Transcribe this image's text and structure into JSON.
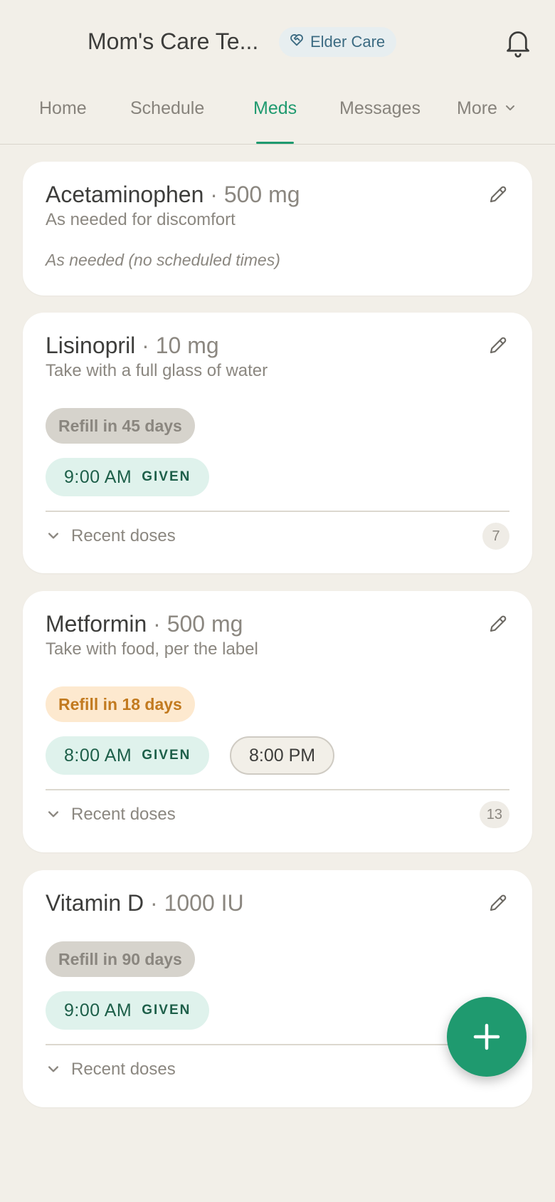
{
  "header": {
    "title": "Mom's Care Te...",
    "badge": "Elder Care"
  },
  "tabs": [
    {
      "label": "Home"
    },
    {
      "label": "Schedule"
    },
    {
      "label": "Meds"
    },
    {
      "label": "Messages"
    },
    {
      "label": "More"
    }
  ],
  "active_tab": "Meds",
  "meds": [
    {
      "name": "Acetaminophen",
      "dose": "· 500 mg",
      "note": "As needed for discomfort",
      "schedule_note": "As needed (no scheduled times)"
    },
    {
      "name": "Lisinopril",
      "dose": "· 10 mg",
      "note": "Take with a full glass of water",
      "refill": "Refill in 45 days",
      "doses": [
        {
          "time": "9:00 AM",
          "status": "GIVEN"
        }
      ],
      "recent_label": "Recent doses",
      "recent_count": "7"
    },
    {
      "name": "Metformin",
      "dose": "· 500 mg",
      "note": "Take with food, per the label",
      "refill": "Refill in 18 days",
      "doses": [
        {
          "time": "8:00 AM",
          "status": "GIVEN"
        },
        {
          "time": "8:00 PM",
          "status": ""
        }
      ],
      "recent_label": "Recent doses",
      "recent_count": "13"
    },
    {
      "name": "Vitamin D",
      "dose": "· 1000 IU",
      "refill": "Refill in 90 days",
      "doses": [
        {
          "time": "9:00 AM",
          "status": "GIVEN"
        }
      ],
      "recent_label": "Recent doses"
    }
  ],
  "colors": {
    "accent": "#1f9a6f",
    "background": "#f2efe8",
    "refill_warning": "#c27a1f"
  },
  "icons": {
    "badge": "heart-handshake-icon",
    "notifications": "bell-icon",
    "edit": "pencil-icon",
    "expand": "chevron-down-icon",
    "add": "plus-icon"
  }
}
